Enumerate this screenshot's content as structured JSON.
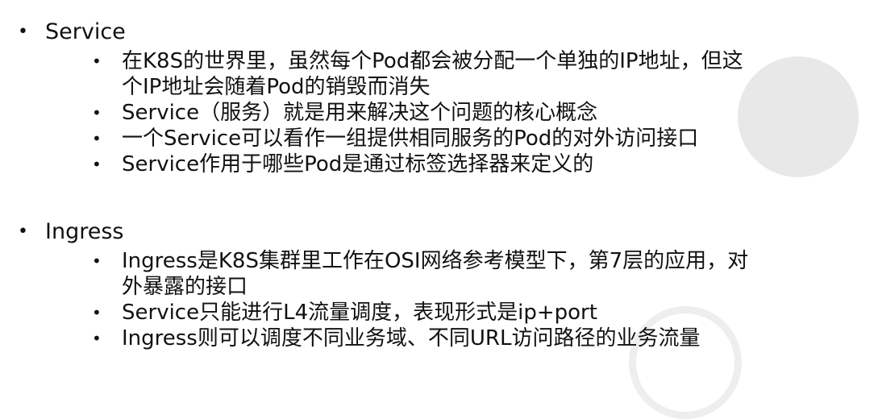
{
  "sections": [
    {
      "title": "Service",
      "items": [
        [
          "在K8S的世界里，虽然每个Pod都会被分配一个单独的IP地址，但这",
          "个IP地址会随着Pod的销毁而消失"
        ],
        [
          "Service（服务）就是用来解决这个问题的核心概念"
        ],
        [
          "一个Service可以看作一组提供相同服务的Pod的对外访问接口"
        ],
        [
          "Service作用于哪些Pod是通过标签选择器来定义的"
        ]
      ]
    },
    {
      "title": "Ingress",
      "items": [
        [
          "Ingress是K8S集群里工作在OSI网络参考模型下，第7层的应用，对",
          "外暴露的接口"
        ],
        [
          "Service只能进行L4流量调度，表现形式是ip+port"
        ],
        [
          "Ingress则可以调度不同业务域、不同URL访问路径的业务流量"
        ]
      ]
    }
  ],
  "bullet_char": "•"
}
